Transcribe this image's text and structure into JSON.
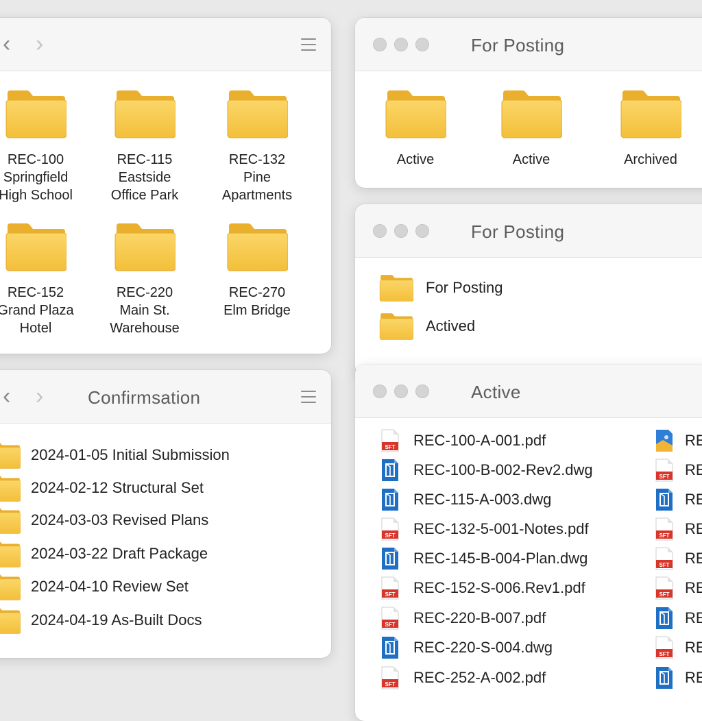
{
  "projects_window": {
    "back_glyph": "‹",
    "forward_glyph": "›",
    "menu_icon": "hamburger-menu-icon",
    "folders": [
      {
        "line1": "REC-100",
        "line2": "Springfield",
        "line3": "High School"
      },
      {
        "line1": "REC-115",
        "line2": "Eastside",
        "line3": "Office Park"
      },
      {
        "line1": "REC-132",
        "line2": "Pine",
        "line3": "Apartments"
      },
      {
        "line1": "REC-152",
        "line2": "Grand Plaza",
        "line3": "Hotel"
      },
      {
        "line1": "REC-220",
        "line2": "Main St.",
        "line3": "Warehouse"
      },
      {
        "line1": "REC-270",
        "line2": "Elm Bridge",
        "line3": ""
      }
    ]
  },
  "for_posting_grid": {
    "title": "For Posting",
    "folders": [
      "Active",
      "Active",
      "Archived"
    ]
  },
  "for_posting_list": {
    "title": "For Posting",
    "items": [
      "For Posting",
      "Actived"
    ]
  },
  "confirmation_window": {
    "title": "Confirmsation",
    "back_glyph": "‹",
    "forward_glyph": "›",
    "items": [
      "2024-01-05 Initial Submission",
      "2024-02-12 Structural Set",
      "2024-03-03 Revised Plans",
      "2024-03-22 Draft Package",
      "2024-04-10 Review Set",
      "2024-04-19 As-Built Docs"
    ]
  },
  "active_window": {
    "title": "Active",
    "files": [
      {
        "name": "REC-100-A-001.pdf",
        "type": "pdf"
      },
      {
        "name": "REC-100-B-002-Rev2.dwg",
        "type": "dwg"
      },
      {
        "name": "REC-115-A-003.dwg",
        "type": "dwg"
      },
      {
        "name": "REC-132-5-001-Notes.pdf",
        "type": "pdf"
      },
      {
        "name": "REC-145-B-004-Plan.dwg",
        "type": "dwg"
      },
      {
        "name": "REC-152-S-006.Rev1.pdf",
        "type": "pdf"
      },
      {
        "name": "REC-220-B-007.pdf",
        "type": "pdf"
      },
      {
        "name": "REC-220-S-004.dwg",
        "type": "dwg"
      },
      {
        "name": "REC-252-A-002.pdf",
        "type": "pdf"
      }
    ],
    "files_col2": [
      {
        "name": "RE",
        "type": "img"
      },
      {
        "name": "RE",
        "type": "pdf"
      },
      {
        "name": "RE",
        "type": "dwg"
      },
      {
        "name": "RE",
        "type": "pdf"
      },
      {
        "name": "RE",
        "type": "pdf"
      },
      {
        "name": "RE",
        "type": "pdf"
      },
      {
        "name": "RE",
        "type": "dwg"
      },
      {
        "name": "RE",
        "type": "pdf"
      },
      {
        "name": "RE",
        "type": "dwg"
      }
    ],
    "pdf_badge": "SFT"
  },
  "colors": {
    "folder_body": "#f7c948",
    "folder_tab": "#eeb12e",
    "pdf_red": "#d8362b",
    "dwg_blue": "#1f6fc4"
  }
}
